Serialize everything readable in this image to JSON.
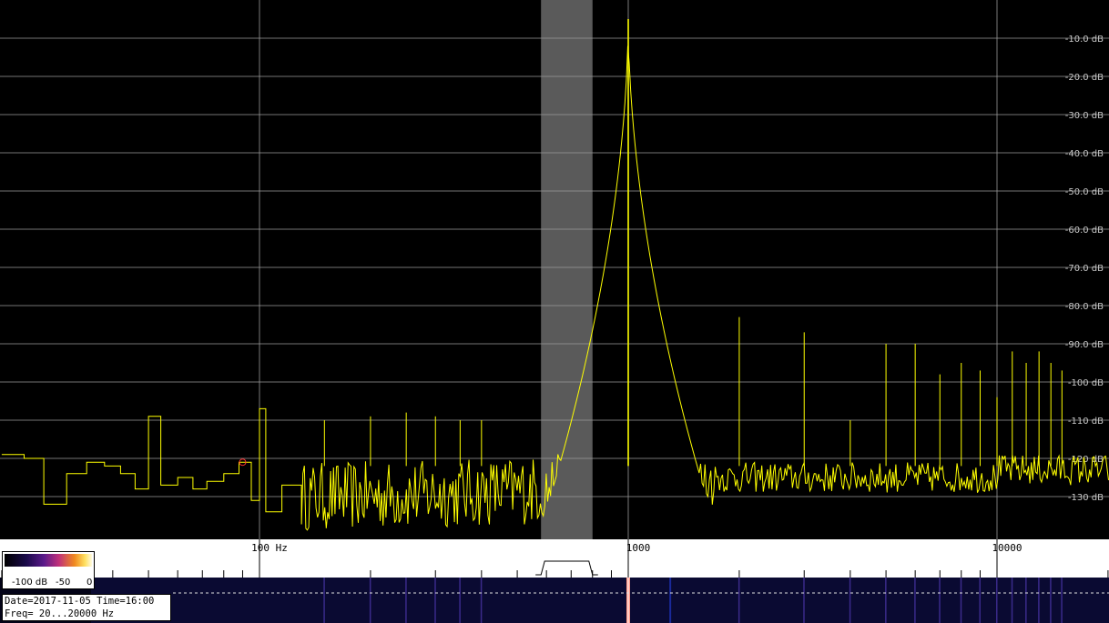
{
  "chart_data": {
    "type": "line",
    "x_scale": "log",
    "xlim": [
      20,
      16000
    ],
    "ylim": [
      -135,
      0
    ],
    "grid": true,
    "x_tick_labels": [
      "100 Hz",
      "1000",
      "10000"
    ],
    "y_tick_labels": [
      "-10.0 dB",
      "-20.0 dB",
      "-30.0 dB",
      "-40.0 dB",
      "-50.0 dB",
      "-60.0 dB",
      "-70.0 dB",
      "-80.0 dB",
      "-90.0 dB",
      "-100 dB",
      "-110 dB",
      "-120 dB",
      "-130 dB"
    ],
    "y_tick_values": [
      -10,
      -20,
      -30,
      -40,
      -50,
      -60,
      -70,
      -80,
      -90,
      -100,
      -110,
      -120,
      -130
    ],
    "marked_band_hz": [
      580,
      800
    ],
    "series": [
      {
        "color": "#ffff00",
        "noise_floor_db": -126,
        "points": [
          {
            "x": 20,
            "y": -119
          },
          {
            "x": 23,
            "y": -120
          },
          {
            "x": 26,
            "y": -132
          },
          {
            "x": 30,
            "y": -124
          },
          {
            "x": 34,
            "y": -121
          },
          {
            "x": 38,
            "y": -122
          },
          {
            "x": 42,
            "y": -124
          },
          {
            "x": 46,
            "y": -128
          },
          {
            "x": 50,
            "y": -109
          },
          {
            "x": 54,
            "y": -127
          },
          {
            "x": 60,
            "y": -125
          },
          {
            "x": 66,
            "y": -128
          },
          {
            "x": 72,
            "y": -126
          },
          {
            "x": 80,
            "y": -124
          },
          {
            "x": 88,
            "y": -121
          },
          {
            "x": 95,
            "y": -131
          },
          {
            "x": 100,
            "y": -107
          },
          {
            "x": 104,
            "y": -134
          },
          {
            "x": 115,
            "y": -127
          },
          {
            "x": 130,
            "y": -131
          }
        ],
        "peaks": [
          {
            "x": 1000,
            "y": -5
          },
          {
            "x": 2000,
            "y": -83
          },
          {
            "x": 3000,
            "y": -87
          },
          {
            "x": 4000,
            "y": -110
          },
          {
            "x": 5000,
            "y": -90
          },
          {
            "x": 6000,
            "y": -90
          },
          {
            "x": 7000,
            "y": -98
          },
          {
            "x": 8000,
            "y": -95
          },
          {
            "x": 9000,
            "y": -97
          },
          {
            "x": 10000,
            "y": -104
          },
          {
            "x": 11000,
            "y": -92
          },
          {
            "x": 12000,
            "y": -95
          },
          {
            "x": 13000,
            "y": -92
          },
          {
            "x": 14000,
            "y": -95
          },
          {
            "x": 15000,
            "y": -97
          },
          {
            "x": 150,
            "y": -110
          },
          {
            "x": 200,
            "y": -109
          },
          {
            "x": 250,
            "y": -108
          },
          {
            "x": 300,
            "y": -109
          },
          {
            "x": 350,
            "y": -110
          },
          {
            "x": 400,
            "y": -110
          }
        ]
      }
    ],
    "peak_marker": {
      "x": 90,
      "y": -121,
      "color": "#ff3030"
    }
  },
  "colorbar": {
    "label_min": "-100 dB",
    "label_mid": "-50",
    "label_max": "0"
  },
  "info": {
    "line1": "Date=2017-11-05 Time=16:00",
    "line2": "Freq= 20...20000 Hz"
  },
  "colors": {
    "background": "#000000",
    "trace": "#ffff00",
    "grid": "#9a9a9a",
    "band": "#5a5a5a"
  }
}
